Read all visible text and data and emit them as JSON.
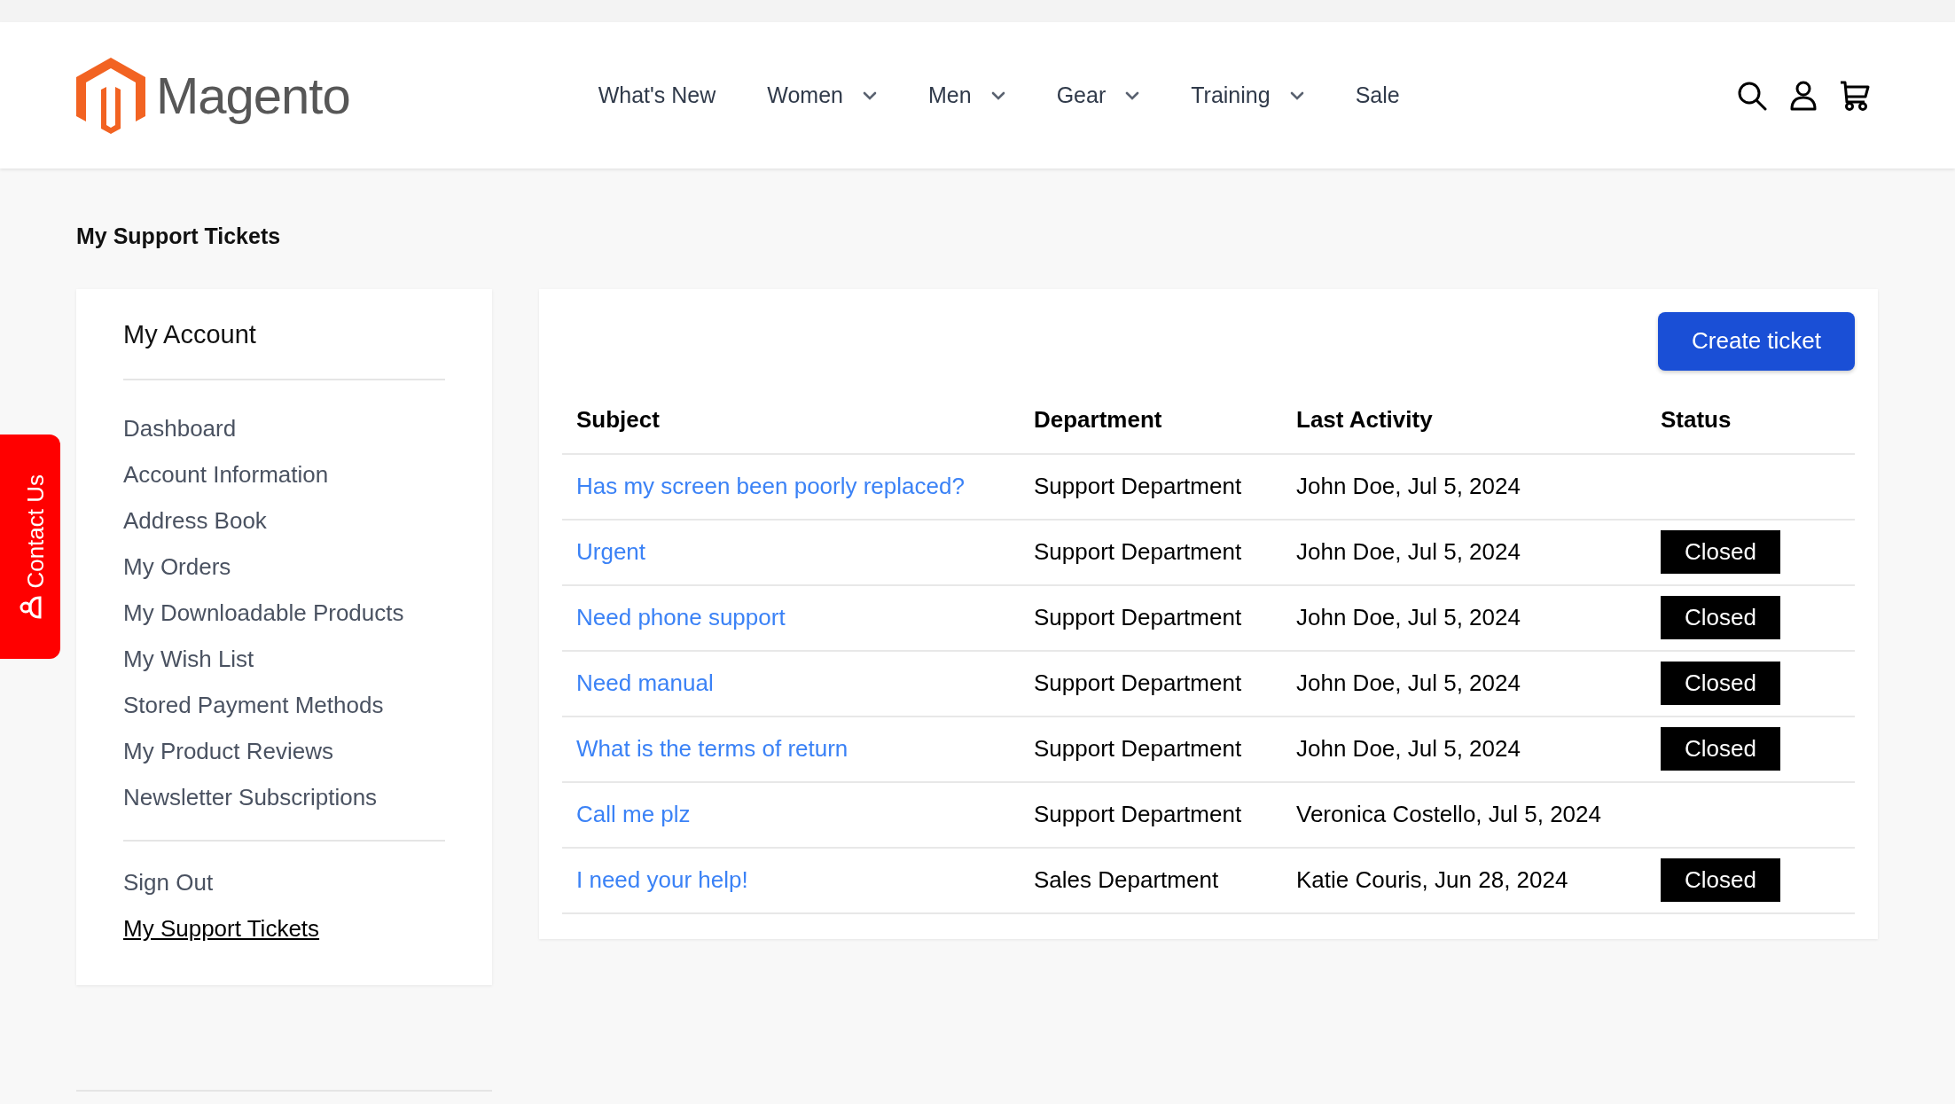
{
  "header": {
    "logo_text": "Magento",
    "nav": [
      {
        "label": "What's New",
        "has_menu": false
      },
      {
        "label": "Women",
        "has_menu": true
      },
      {
        "label": "Men",
        "has_menu": true
      },
      {
        "label": "Gear",
        "has_menu": true
      },
      {
        "label": "Training",
        "has_menu": true
      },
      {
        "label": "Sale",
        "has_menu": false
      }
    ]
  },
  "contact_tab": {
    "label": "Contact Us"
  },
  "page_title": "My Support Tickets",
  "sidebar": {
    "title": "My Account",
    "items": [
      {
        "label": "Dashboard",
        "selected": false
      },
      {
        "label": "Account Information",
        "selected": false
      },
      {
        "label": "Address Book",
        "selected": false
      },
      {
        "label": "My Orders",
        "selected": false
      },
      {
        "label": "My Downloadable Products",
        "selected": false
      },
      {
        "label": "My Wish List",
        "selected": false
      },
      {
        "label": "Stored Payment Methods",
        "selected": false
      },
      {
        "label": "My Product Reviews",
        "selected": false
      },
      {
        "label": "Newsletter Subscriptions",
        "selected": false
      }
    ],
    "footer_items": [
      {
        "label": "Sign Out",
        "selected": false
      },
      {
        "label": "My Support Tickets",
        "selected": true
      }
    ]
  },
  "create_button": "Create ticket",
  "table": {
    "columns": [
      "Subject",
      "Department",
      "Last Activity",
      "Status"
    ],
    "rows": [
      {
        "subject": "Has my screen been poorly replaced?",
        "department": "Support Department",
        "last_activity": "John Doe, Jul 5, 2024"
      },
      {
        "subject": "Urgent",
        "department": "Support Department",
        "last_activity": "John Doe, Jul 5, 2024",
        "status": "Closed"
      },
      {
        "subject": "Need phone support",
        "department": "Support Department",
        "last_activity": "John Doe, Jul 5, 2024",
        "status": "Closed"
      },
      {
        "subject": "Need manual",
        "department": "Support Department",
        "last_activity": "John Doe, Jul 5, 2024",
        "status": "Closed"
      },
      {
        "subject": "What is the terms of return",
        "department": "Support Department",
        "last_activity": "John Doe, Jul 5, 2024",
        "status": "Closed"
      },
      {
        "subject": "Call me plz",
        "department": "Support Department",
        "last_activity": "Veronica Costello, Jul 5, 2024"
      },
      {
        "subject": "I need your help!",
        "department": "Sales Department",
        "last_activity": "Katie Couris, Jun 28, 2024",
        "status": "Closed"
      }
    ]
  }
}
